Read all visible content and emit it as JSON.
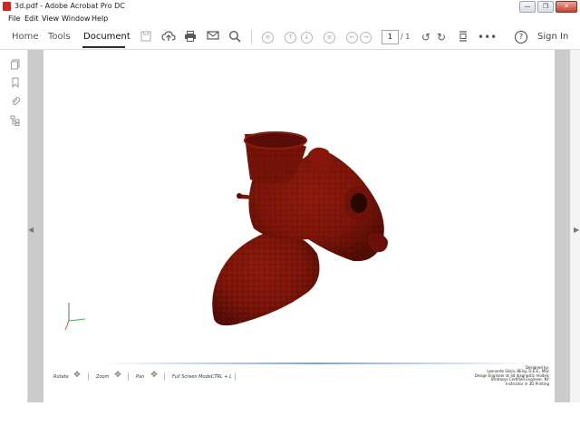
{
  "window": {
    "title": "3d.pdf - Adobe Acrobat Pro DC",
    "controls": {
      "minimize": "—",
      "restore": "❐",
      "close": "✕"
    }
  },
  "menu": {
    "items": [
      "File",
      "Edit",
      "View",
      "Window",
      "Help"
    ]
  },
  "toolbar": {
    "tabs": {
      "home": "Home",
      "tools": "Tools",
      "document": "Document"
    },
    "page_current": "1",
    "page_total": "/ 1",
    "help": "?",
    "sign_in": "Sign In"
  },
  "footer_controls": {
    "rotate": "Rotate",
    "zoom": "Zoom",
    "pan": "Pan",
    "fullscreen": "Full Screen Mode:",
    "shortcut": "CTRL + L"
  },
  "credits": [
    "Designed by:",
    "Leonardo Silvio, BEng, D.E.E., MSc",
    "Design Engineer at 3d diagnostic models",
    "Stratasys Certified Engineer, NY",
    "Instructor in 3D Printing"
  ],
  "colors": {
    "model_fill": "#7a1409",
    "model_shadow": "#4e0c05",
    "axis_x": "#e04a3a",
    "axis_y": "#3bbf4a",
    "axis_z": "#4a62d8"
  },
  "icons": {
    "save": "save-icon",
    "upload": "cloud-upload-icon",
    "print": "printer-icon",
    "email": "mail-icon",
    "search": "search-icon"
  }
}
